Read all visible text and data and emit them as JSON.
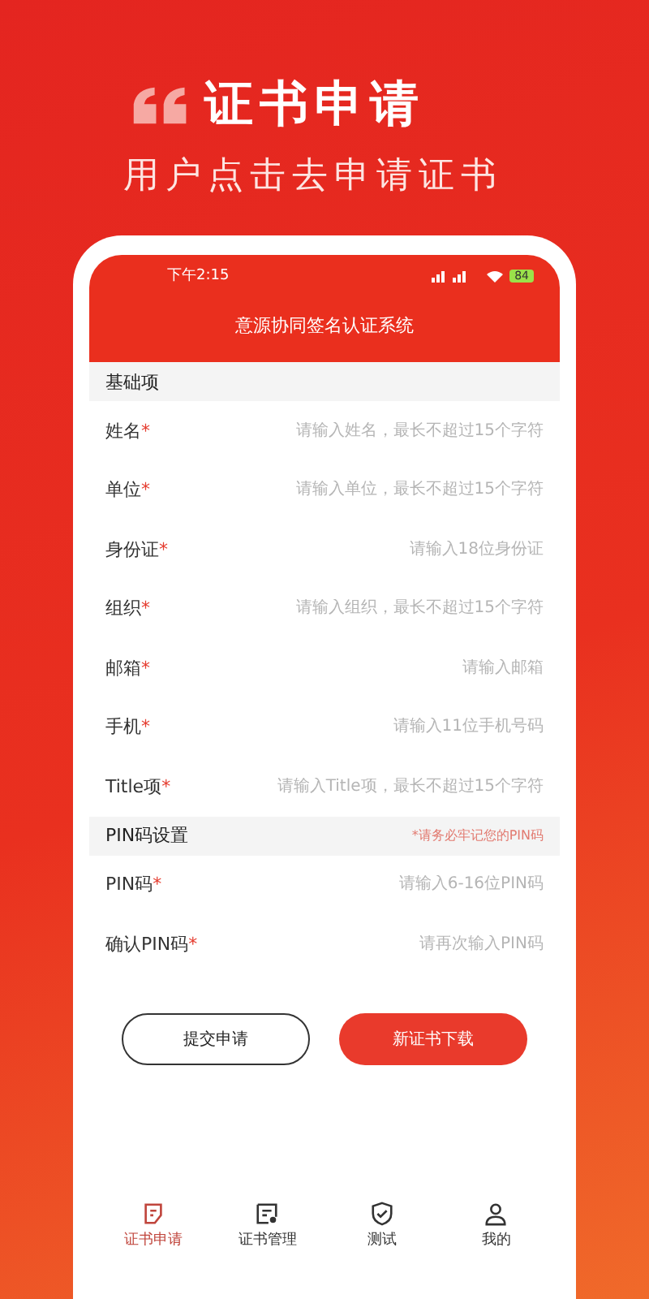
{
  "promo": {
    "title": "证书申请",
    "subtitle": "用户点击去申请证书"
  },
  "status_bar": {
    "time": "下午2:15",
    "battery": "84"
  },
  "app_bar": {
    "title": "意源协同签名认证系统"
  },
  "sections": [
    {
      "title": "基础项",
      "fields": [
        {
          "label": "姓名",
          "mark": "*",
          "placeholder": "请输入姓名，最长不超过15个字符"
        },
        {
          "label": "单位",
          "mark": "*",
          "placeholder": "请输入单位，最长不超过15个字符"
        },
        {
          "label": "身份证",
          "mark": "*",
          "placeholder": "请输入18位身份证"
        },
        {
          "label": "组织",
          "mark": "*",
          "placeholder": "请输入组织，最长不超过15个字符"
        },
        {
          "label": "邮箱",
          "mark": "*",
          "placeholder": "请输入邮箱"
        },
        {
          "label": "手机",
          "mark": "*",
          "placeholder": "请输入11位手机号码"
        },
        {
          "label": "Title项",
          "mark": "*",
          "placeholder": "请输入Title项，最长不超过15个字符"
        }
      ]
    },
    {
      "title": "PIN码设置",
      "note": "*请务必牢记您的PIN码",
      "fields": [
        {
          "label": "PIN码",
          "mark": "*",
          "placeholder": "请输入6-16位PIN码"
        },
        {
          "label": "确认PIN码",
          "mark": "*",
          "placeholder": "请再次输入PIN码"
        }
      ]
    }
  ],
  "buttons": [
    {
      "label": "提交申请",
      "kind": "outline"
    },
    {
      "label": "新证书下载",
      "kind": "filled"
    }
  ],
  "tabs": [
    {
      "label": "证书申请",
      "kind": "form",
      "selected": true
    },
    {
      "label": "证书管理",
      "kind": "cert",
      "selected": false
    },
    {
      "label": "测试",
      "kind": "shield",
      "selected": false
    },
    {
      "label": "我的",
      "kind": "user",
      "selected": false
    }
  ]
}
